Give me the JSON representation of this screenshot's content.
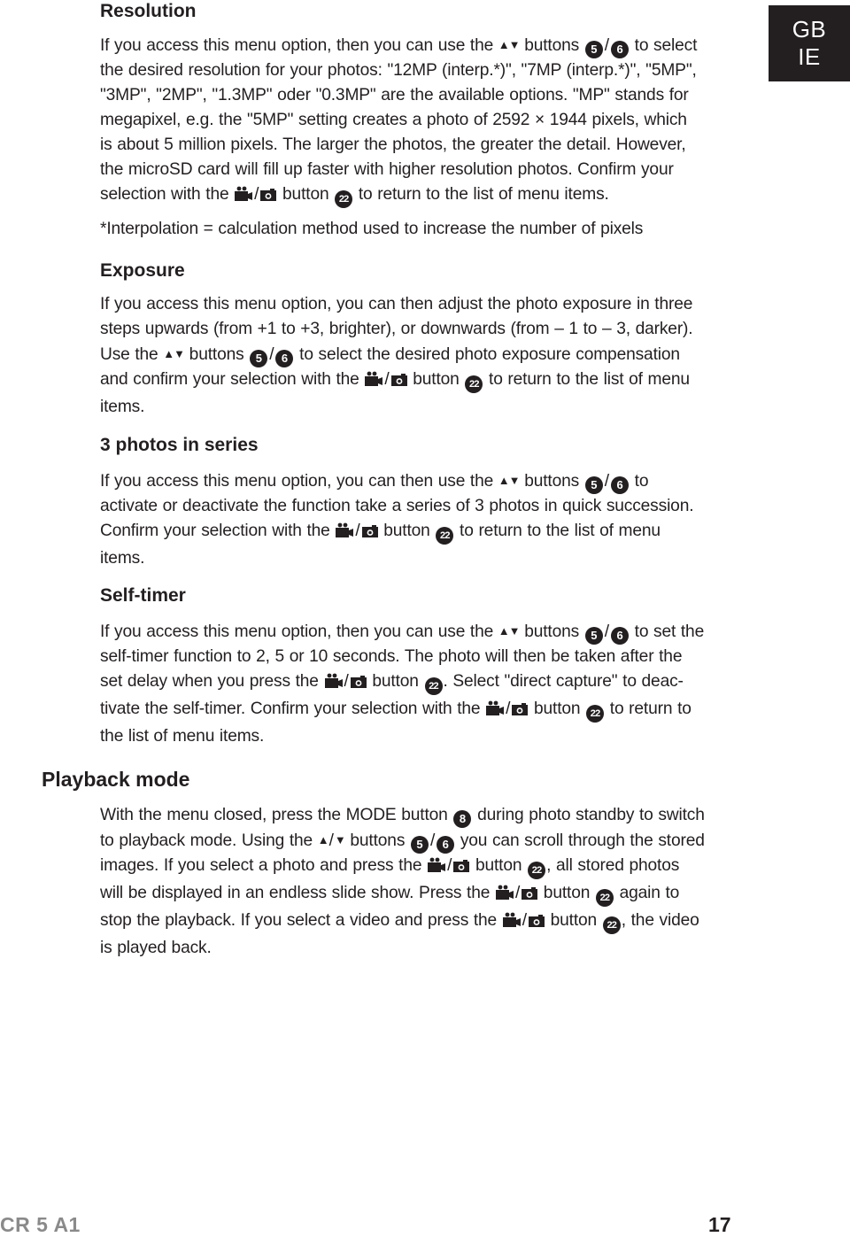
{
  "language_tab": {
    "line1": "GB",
    "line2": "IE"
  },
  "footer": {
    "model": "CR 5 A1",
    "page_number": "17"
  },
  "sections": [
    {
      "heading": "Resolution",
      "paragraphs": [
        [
          [
            {
              "t": "text",
              "v": "If you access this menu option, then you can use the "
            },
            {
              "t": "updown-icon"
            },
            {
              "t": "text",
              "v": " buttons "
            },
            {
              "t": "badge",
              "v": "5"
            },
            {
              "t": "slash"
            },
            {
              "t": "badge",
              "v": "6"
            },
            {
              "t": "text",
              "v": " to select"
            }
          ],
          [
            {
              "t": "text",
              "v": "the desired resolution for your photos: \"12MP (interp.*)\", \"7MP (interp.*)\", \"5MP\","
            }
          ],
          [
            {
              "t": "text",
              "v": "\"3MP\", \"2MP\", \"1.3MP\" oder \"0.3MP\" are the available options. \"MP\" stands for"
            }
          ],
          [
            {
              "t": "text",
              "v": "megapixel, e.g. the \"5MP\" setting creates a photo of 2592 × 1944 pixels, which"
            }
          ],
          [
            {
              "t": "text",
              "v": "is about 5 million pixels. The larger the photos, the greater the detail. However,"
            }
          ],
          [
            {
              "t": "text",
              "v": "the microSD card will fill up faster with higher resolution photos. Confirm your"
            }
          ],
          [
            {
              "t": "text",
              "v": "selection with the "
            },
            {
              "t": "video-icon"
            },
            {
              "t": "slash"
            },
            {
              "t": "camera-icon"
            },
            {
              "t": "text",
              "v": " button "
            },
            {
              "t": "badge",
              "v": "22"
            },
            {
              "t": "text",
              "v": " to return to the list of menu items."
            }
          ]
        ],
        [
          [
            {
              "t": "text",
              "v": "*Interpolation = calculation method used to increase the number of pixels"
            }
          ]
        ]
      ]
    },
    {
      "heading": "Exposure",
      "paragraphs": [
        [
          [
            {
              "t": "text",
              "v": "If you access this menu option, you can then adjust the photo exposure in three"
            }
          ],
          [
            {
              "t": "text",
              "v": "steps upwards (from +1 to +3, brighter), or downwards (from – 1 to – 3, darker)."
            }
          ],
          [
            {
              "t": "text",
              "v": "Use the "
            },
            {
              "t": "updown-icon"
            },
            {
              "t": "text",
              "v": " buttons "
            },
            {
              "t": "badge",
              "v": "5"
            },
            {
              "t": "slash"
            },
            {
              "t": "badge",
              "v": "6"
            },
            {
              "t": "text",
              "v": " to select the desired photo exposure compensation"
            }
          ],
          [
            {
              "t": "text",
              "v": "and confirm your selection with the "
            },
            {
              "t": "video-icon"
            },
            {
              "t": "slash"
            },
            {
              "t": "camera-icon"
            },
            {
              "t": "text",
              "v": " button "
            },
            {
              "t": "badge",
              "v": "22"
            },
            {
              "t": "text",
              "v": " to return to the list of menu"
            }
          ],
          [
            {
              "t": "text",
              "v": "items."
            }
          ]
        ]
      ]
    },
    {
      "heading": "3 photos in series",
      "paragraphs": [
        [
          [
            {
              "t": "text",
              "v": "If you access this menu option, you can then use the "
            },
            {
              "t": "updown-icon"
            },
            {
              "t": "text",
              "v": " buttons "
            },
            {
              "t": "badge",
              "v": "5"
            },
            {
              "t": "slash"
            },
            {
              "t": "badge",
              "v": "6"
            },
            {
              "t": "text",
              "v": " to"
            }
          ],
          [
            {
              "t": "text",
              "v": "activate or deactivate the function take a series of 3 photos in quick succession."
            }
          ],
          [
            {
              "t": "text",
              "v": "Confirm your selection with the "
            },
            {
              "t": "video-icon"
            },
            {
              "t": "slash"
            },
            {
              "t": "camera-icon"
            },
            {
              "t": "text",
              "v": " button "
            },
            {
              "t": "badge",
              "v": "22"
            },
            {
              "t": "text",
              "v": " to return to the list of menu"
            }
          ],
          [
            {
              "t": "text",
              "v": "items."
            }
          ]
        ]
      ]
    },
    {
      "heading": "Self-timer",
      "paragraphs": [
        [
          [
            {
              "t": "text",
              "v": "If you access this menu option, then you can use the "
            },
            {
              "t": "updown-icon"
            },
            {
              "t": "text",
              "v": " buttons "
            },
            {
              "t": "badge",
              "v": "5"
            },
            {
              "t": "slash"
            },
            {
              "t": "badge",
              "v": "6"
            },
            {
              "t": "text",
              "v": " to set the"
            }
          ],
          [
            {
              "t": "text",
              "v": "self-timer function to 2, 5 or 10 seconds. The photo will then be taken after the"
            }
          ],
          [
            {
              "t": "text",
              "v": "set delay when you press the "
            },
            {
              "t": "video-icon"
            },
            {
              "t": "slash"
            },
            {
              "t": "camera-icon"
            },
            {
              "t": "text",
              "v": " button "
            },
            {
              "t": "badge",
              "v": "22"
            },
            {
              "t": "text",
              "v": ". Select \"direct capture\" to deac-"
            }
          ],
          [
            {
              "t": "text",
              "v": "tivate the self-timer. Confirm your selection with the "
            },
            {
              "t": "video-icon"
            },
            {
              "t": "slash"
            },
            {
              "t": "camera-icon"
            },
            {
              "t": "text",
              "v": " button "
            },
            {
              "t": "badge",
              "v": "22"
            },
            {
              "t": "text",
              "v": " to return to"
            }
          ],
          [
            {
              "t": "text",
              "v": "the list of menu items."
            }
          ]
        ]
      ]
    },
    {
      "heading": "Playback mode",
      "level": 1,
      "paragraphs": [
        [
          [
            {
              "t": "text",
              "v": "With the menu closed, press the MODE button "
            },
            {
              "t": "badge",
              "v": "8"
            },
            {
              "t": "text",
              "v": " during photo standby to switch"
            }
          ],
          [
            {
              "t": "text",
              "v": "to playback mode. Using the "
            },
            {
              "t": "up-icon"
            },
            {
              "t": "slash"
            },
            {
              "t": "down-icon"
            },
            {
              "t": "text",
              "v": " buttons "
            },
            {
              "t": "badge",
              "v": "5"
            },
            {
              "t": "slash"
            },
            {
              "t": "badge",
              "v": "6"
            },
            {
              "t": "text",
              "v": " you can scroll through the stored"
            }
          ],
          [
            {
              "t": "text",
              "v": "images. If you select a photo and press the "
            },
            {
              "t": "video-icon"
            },
            {
              "t": "slash"
            },
            {
              "t": "camera-icon"
            },
            {
              "t": "text",
              "v": " button "
            },
            {
              "t": "badge",
              "v": "22"
            },
            {
              "t": "text",
              "v": ", all stored photos"
            }
          ],
          [
            {
              "t": "text",
              "v": "will be displayed in an endless slide show. Press the "
            },
            {
              "t": "video-icon"
            },
            {
              "t": "slash"
            },
            {
              "t": "camera-icon"
            },
            {
              "t": "text",
              "v": " button "
            },
            {
              "t": "badge",
              "v": "22"
            },
            {
              "t": "text",
              "v": " again to"
            }
          ],
          [
            {
              "t": "text",
              "v": "stop the playback. If you select a video and press the "
            },
            {
              "t": "video-icon"
            },
            {
              "t": "slash"
            },
            {
              "t": "camera-icon"
            },
            {
              "t": "text",
              "v": " button "
            },
            {
              "t": "badge",
              "v": "22"
            },
            {
              "t": "text",
              "v": ", the video"
            }
          ],
          [
            {
              "t": "text",
              "v": "is played back."
            }
          ]
        ]
      ]
    }
  ]
}
